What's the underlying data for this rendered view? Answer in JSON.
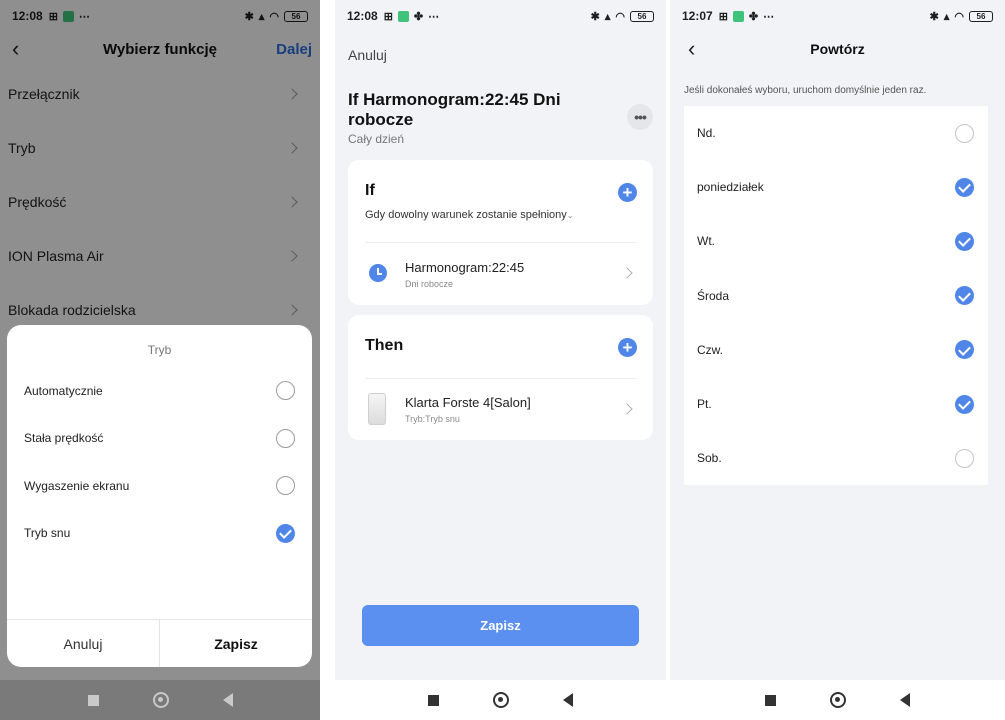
{
  "panel1": {
    "status": {
      "time": "12:08",
      "battery": "56"
    },
    "header": {
      "back": "‹",
      "title": "Wybierz funkcję",
      "next": "Dalej"
    },
    "functions": [
      "Przełącznik",
      "Tryb",
      "Prędkość",
      "ION Plasma Air",
      "Blokada rodzicielska"
    ],
    "sheet": {
      "title": "Tryb",
      "options": [
        {
          "label": "Automatycznie",
          "selected": false
        },
        {
          "label": "Stała prędkość",
          "selected": false
        },
        {
          "label": "Wygaszenie ekranu",
          "selected": false
        },
        {
          "label": "Tryb snu",
          "selected": true
        }
      ],
      "cancel": "Anuluj",
      "save": "Zapisz"
    }
  },
  "panel2": {
    "status": {
      "time": "12:08",
      "battery": "56"
    },
    "cancel": "Anuluj",
    "title": "If Harmonogram:22:45 Dni robocze",
    "subtitle": "Cały dzień",
    "more": "•••",
    "if_card": {
      "heading": "If",
      "description": "Gdy dowolny warunek zostanie spełniony",
      "item_title": "Harmonogram:22:45",
      "item_sub": "Dni robocze"
    },
    "then_card": {
      "heading": "Then",
      "item_title": "Klarta Forste 4[Salon]",
      "item_sub": "Tryb:Tryb snu"
    },
    "save": "Zapisz"
  },
  "panel3": {
    "status": {
      "time": "12:07",
      "battery": "56"
    },
    "header": {
      "back": "‹",
      "title": "Powtórz"
    },
    "hint": "Jeśli dokonałeś wyboru, uruchom domyślnie jeden raz.",
    "days": [
      {
        "label": "Nd.",
        "checked": false
      },
      {
        "label": "poniedziałek",
        "checked": true
      },
      {
        "label": "Wt.",
        "checked": true
      },
      {
        "label": "Środa",
        "checked": true
      },
      {
        "label": "Czw.",
        "checked": true
      },
      {
        "label": "Pt.",
        "checked": true
      },
      {
        "label": "Sob.",
        "checked": false
      }
    ]
  },
  "colors": {
    "accent": "#4f86e8",
    "link": "#2c6bd8",
    "button": "#5b8ff0"
  }
}
